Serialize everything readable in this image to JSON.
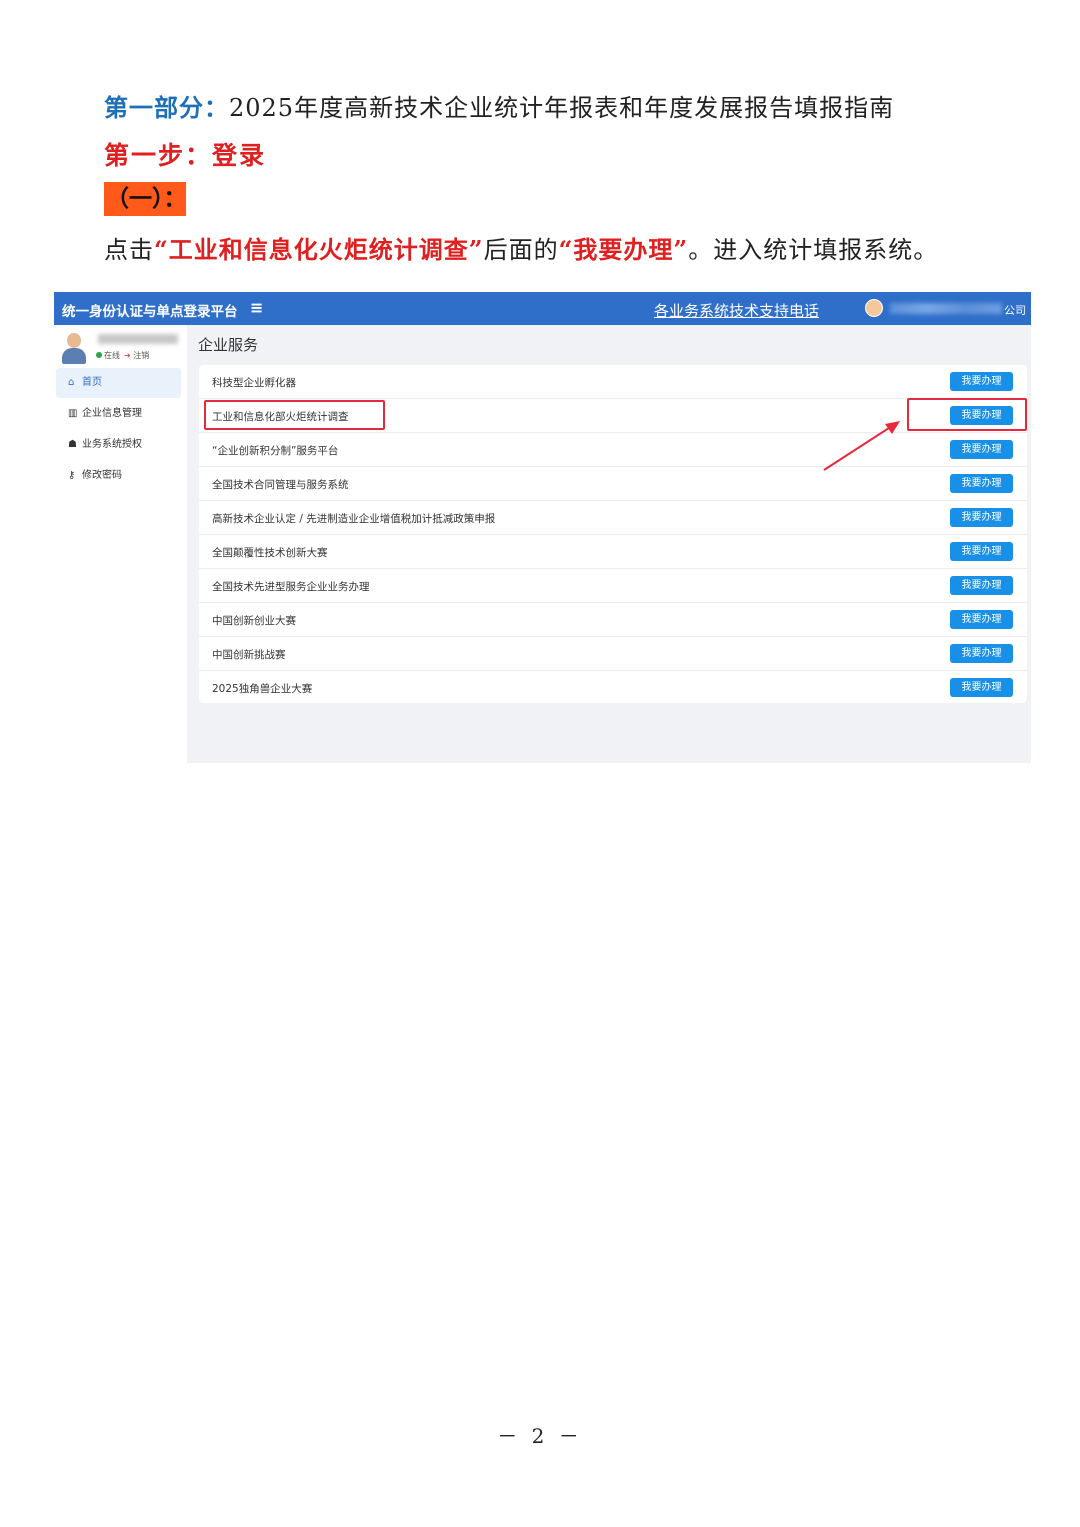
{
  "heading": {
    "part_label": "第一部分：",
    "part_title": "2025年度高新技术企业统计年报表和年度发展报告填报指南",
    "step": "第一步：登录",
    "sub": "（一）：",
    "instruction": {
      "pre": "点击",
      "target": "“工业和信息化火炬统计调查”",
      "mid": "后面的",
      "button": "“我要办理”",
      "post": "。进入统计填报系统。"
    }
  },
  "screenshot": {
    "topbar": {
      "platform": "统一身份认证与单点登录平台",
      "menu_icon": "≡",
      "support": "各业务系统技术支持电话",
      "company_suffix": "公司",
      "colors": {
        "bar": "#2f6fc9"
      }
    },
    "sidebar": {
      "status_online": "在线",
      "status_logout": "注销",
      "items": [
        {
          "icon": "home-icon",
          "label": "首页"
        },
        {
          "icon": "bank-icon",
          "label": "企业信息管理"
        },
        {
          "icon": "users-icon",
          "label": "业务系统授权"
        },
        {
          "icon": "key-icon",
          "label": "修改密码"
        }
      ]
    },
    "main": {
      "title": "企业服务",
      "button_label": "我要办理",
      "services": [
        "科技型企业孵化器",
        "工业和信息化部火炬统计调查",
        "“企业创新积分制”服务平台",
        "全国技术合同管理与服务系统",
        "高新技术企业认定 / 先进制造业企业增值税加计抵减政策申报",
        "全国颠覆性技术创新大赛",
        "全国技术先进型服务企业业务办理",
        "中国创新创业大赛",
        "中国创新挑战赛",
        "2025独角兽企业大赛"
      ],
      "highlighted_index": 1
    }
  },
  "page_number": "－ 2 －"
}
